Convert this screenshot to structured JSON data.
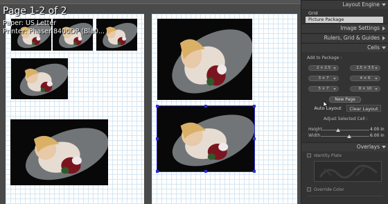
{
  "overlay": {
    "title": "Page 1-2 of 2",
    "paper": "Paper:  US Letter",
    "printer": "Printer:  Phaser 8400DP (Bla0..."
  },
  "panel": {
    "layout_engine": {
      "title": "Layout Engine",
      "items": [
        "Grid",
        "Picture Package"
      ],
      "active": "Picture Package"
    },
    "image_settings": {
      "title": "Image Settings"
    },
    "rulers": {
      "title": "Rulers, Grid & Guides"
    },
    "cells": {
      "title": "Cells",
      "add_to_package": "Add to Package :",
      "sizes": [
        "2 × 2.5",
        "2.5 × 3.5",
        "3 × 7",
        "4 × 6",
        "5 × 7",
        "8 × 10"
      ],
      "new_page": "New Page",
      "auto_layout": "Auto Layout",
      "clear_layout": "Clear Layout",
      "adjust_label": "Adjust Selected Cell :",
      "height_label": "Height",
      "height_value": "4.00 in",
      "width_label": "Width",
      "width_value": "6.00 in"
    },
    "overlays": {
      "title": "Overlays",
      "identity_plate": "Identity Plate",
      "override_color": "Override Color"
    }
  },
  "colors": {
    "panel_bg": "#333333",
    "selection": "#2d2dd9",
    "active_item": "#cfcfcf"
  }
}
